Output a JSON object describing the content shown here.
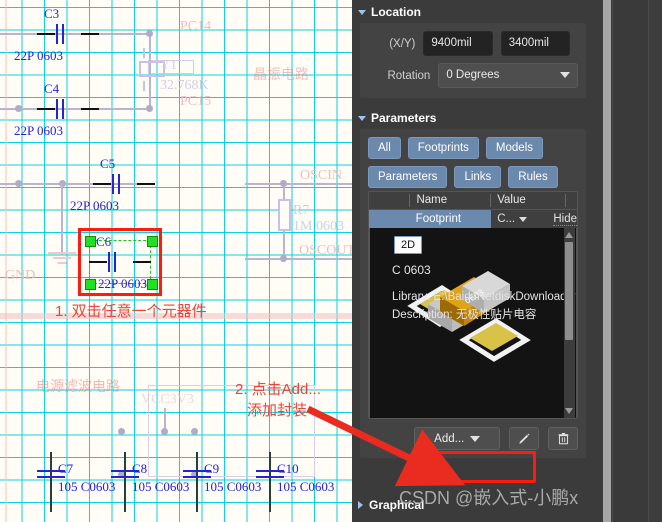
{
  "panel": {
    "location": {
      "section_title": "Location",
      "xy_label": "(X/Y)",
      "x_value": "9400mil",
      "y_value": "3400mil",
      "rotation_label": "Rotation",
      "rotation_value": "0 Degrees"
    },
    "parameters": {
      "section_title": "Parameters",
      "filter_buttons": [
        "All",
        "Footprints",
        "Models",
        "Parameters",
        "Links",
        "Rules"
      ],
      "table": {
        "headers": [
          "",
          "Name",
          "Value",
          ""
        ],
        "rows": [
          {
            "name": "Footprint",
            "value": "C...",
            "visibility": "Hide"
          }
        ]
      },
      "preview": {
        "badge": "2D",
        "model_name": "C 0603",
        "library": "Library: E:\\BaiduNetdiskDownload\\stm..",
        "description": "Description: 无极性贴片电容"
      },
      "buttons": {
        "add_label": "Add...",
        "edit_label": "",
        "delete_label": ""
      }
    },
    "graphical": {
      "section_title": "Graphical"
    }
  },
  "watermark": "CSDN @嵌入式-小鹏x",
  "schematic": {
    "title_blocks": [
      {
        "text": "晶振电路"
      },
      {
        "text": "电源滤波电路"
      }
    ],
    "net_labels": [
      "PC14",
      "PC15",
      "OSCIN",
      "OSCOUT",
      "VCC3V3",
      "GND"
    ],
    "components": [
      {
        "refdes": "C3",
        "value": "22P 0603"
      },
      {
        "refdes": "C4",
        "value": "22P 0603"
      },
      {
        "refdes": "C5",
        "value": "22P 0603"
      },
      {
        "refdes": "C6",
        "value": "22P 0603"
      },
      {
        "refdes": "C7",
        "value": "105 C0603"
      },
      {
        "refdes": "C8",
        "value": "105 C0603"
      },
      {
        "refdes": "C9",
        "value": "105 C0603"
      },
      {
        "refdes": "C10",
        "value": "105 C0603"
      },
      {
        "refdes": "Y1",
        "value": "32.768K"
      },
      {
        "refdes": "R7",
        "value": "1M  0603"
      }
    ],
    "annotations": [
      {
        "text": "1. 双击任意一个元器件"
      },
      {
        "text": "2. 点击Add..."
      },
      {
        "text": "添加封装"
      }
    ]
  }
}
